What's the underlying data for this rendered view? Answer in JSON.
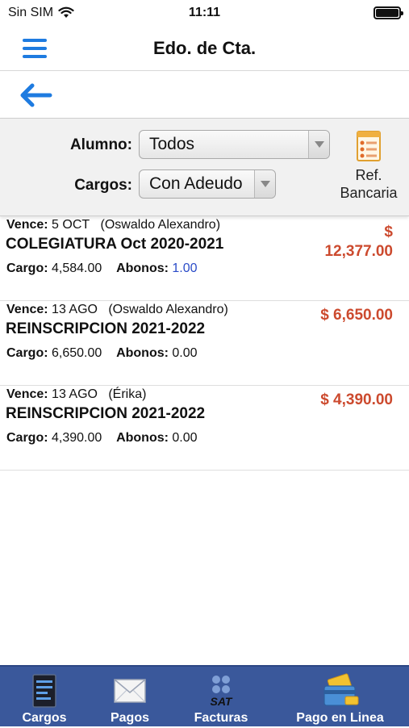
{
  "status": {
    "carrier": "Sin SIM",
    "time": "11:11"
  },
  "header": {
    "title": "Edo. de Cta."
  },
  "filters": {
    "alumno_label": "Alumno:",
    "alumno_value": "Todos",
    "cargos_label": "Cargos:",
    "cargos_value": "Con Adeudo",
    "ref_label_1": "Ref.",
    "ref_label_2": "Bancaria"
  },
  "items": [
    {
      "vence_label": "Vence:",
      "vence_date": "5 OCT",
      "student": "(Oswaldo Alexandro)",
      "concept": "COLEGIATURA Oct 2020-2021",
      "cargo_label": "Cargo:",
      "cargo": "4,584.00",
      "abonos_label": "Abonos:",
      "abonos": "1.00",
      "amount_symbol": "$",
      "amount": "12,377.00"
    },
    {
      "vence_label": "Vence:",
      "vence_date": "13 AGO",
      "student": "(Oswaldo Alexandro)",
      "concept": "REINSCRIPCION 2021-2022",
      "cargo_label": "Cargo:",
      "cargo": "6,650.00",
      "abonos_label": "Abonos:",
      "abonos": "0.00",
      "amount": "$ 6,650.00"
    },
    {
      "vence_label": "Vence:",
      "vence_date": "13 AGO",
      "student": "(Érika)",
      "concept": "REINSCRIPCION 2021-2022",
      "cargo_label": "Cargo:",
      "cargo": "4,390.00",
      "abonos_label": "Abonos:",
      "abonos": "0.00",
      "amount": "$ 4,390.00"
    }
  ],
  "tabs": [
    {
      "label": "Cargos",
      "icon": "document-list-icon"
    },
    {
      "label": "Pagos",
      "icon": "envelope-icon"
    },
    {
      "label": "Facturas",
      "icon": "sat-icon"
    },
    {
      "label": "Pago en Linea",
      "icon": "credit-card-wallet-icon"
    }
  ],
  "colors": {
    "accent": "#1e7be0",
    "amount": "#cc4a2e",
    "tabbar": "#3a589b",
    "abonos_highlight": "#2b4cc8"
  }
}
